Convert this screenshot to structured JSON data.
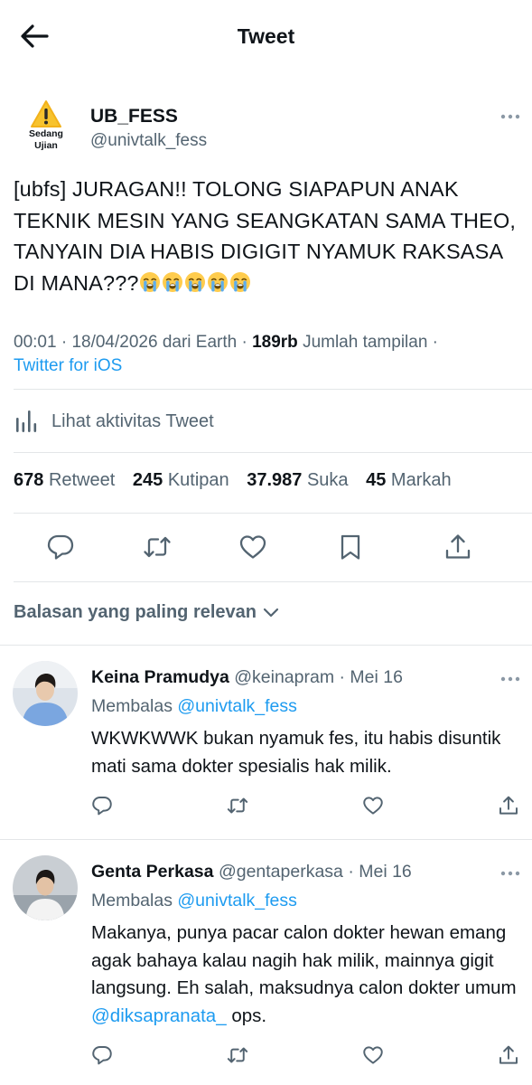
{
  "header": {
    "title": "Tweet"
  },
  "author": {
    "avatar_label_1": "Sedang",
    "avatar_label_2": "Ujian",
    "name": "UB_FESS",
    "handle": "@univtalk_fess"
  },
  "tweet": {
    "text": "[ubfs] JURAGAN!! TOLONG SIAPAPUN ANAK TEKNIK MESIN YANG SEANGKATAN SAMA THEO, TANYAIN DIA HABIS DIGIGIT NYAMUK RAKSASA DI MANA???",
    "emoji_count": 5,
    "time": "00:01",
    "date": "18/04/2026",
    "location": "dari Earth",
    "views": "189rb",
    "views_label": "Jumlah tampilan",
    "source": "Twitter for iOS"
  },
  "activity_label": "Lihat aktivitas Tweet",
  "stats": {
    "retweets": "678",
    "retweets_label": "Retweet",
    "quotes": "245",
    "quotes_label": "Kutipan",
    "likes": "37.987",
    "likes_label": "Suka",
    "bookmarks": "45",
    "bookmarks_label": "Markah"
  },
  "sort_label": "Balasan yang paling relevan",
  "replies": [
    {
      "name": "Keina Pramudya",
      "handle": "@keinapram",
      "date": "Mei 16",
      "replying_label": "Membalas",
      "replying_to": "@univtalk_fess",
      "text": "WKWKWWK bukan nyamuk fes, itu habis disuntik mati sama dokter spesialis hak milik."
    },
    {
      "name": "Genta Perkasa",
      "handle": "@gentaperkasa",
      "date": "Mei 16",
      "replying_label": "Membalas",
      "replying_to": "@univtalk_fess",
      "text_before": "Makanya, punya pacar calon dokter hewan emang agak bahaya kalau nagih hak milik, mainnya gigit langsung. Eh salah, maksudnya calon dokter umum",
      "mention": "@diksapranata_",
      "text_after": "ops."
    }
  ],
  "colors": {
    "accent": "#1d9bf0",
    "text": "#0f1419",
    "muted": "#536471",
    "divider": "#e3e6e8"
  },
  "icons": [
    "back-arrow-icon",
    "warning-icon",
    "more-icon",
    "analytics-icon",
    "reply-icon",
    "retweet-icon",
    "like-icon",
    "bookmark-icon",
    "share-icon",
    "chevron-down-icon",
    "sob-emoji"
  ]
}
